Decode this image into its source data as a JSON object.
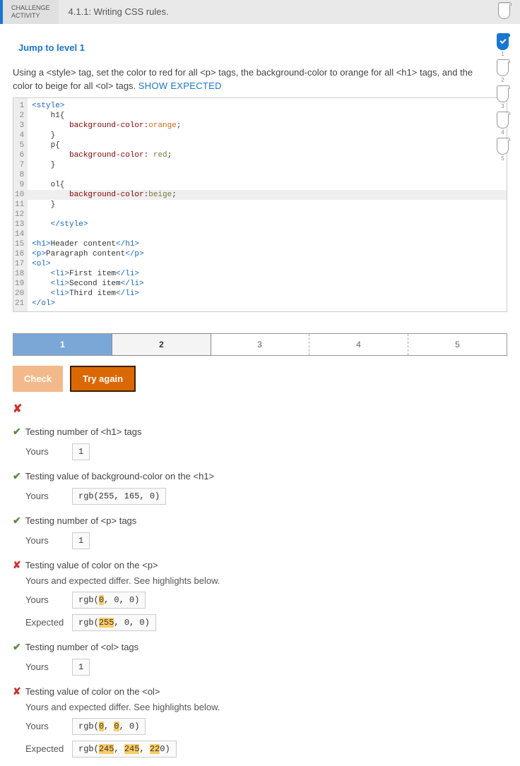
{
  "header": {
    "challenge_label_1": "CHALLENGE",
    "challenge_label_2": "ACTIVITY",
    "title": "4.1.1: Writing CSS rules."
  },
  "progress": [
    "1",
    "2",
    "3",
    "4",
    "5"
  ],
  "jump_link": "Jump to level 1",
  "instruction_pre": "Using a <style> tag, set the color to red for all <p> tags, the background-color to orange for all <h1> tags, and the color to beige for all <ol> tags.  ",
  "show_expected": "SHOW EXPECTED",
  "code_lines": {
    "l1": "<style>",
    "l2": "    h1{",
    "l3_prop": "        background-color:",
    "l3_val": "orange",
    "l3_end": ";",
    "l4": "    }",
    "l5": "    p{",
    "l6_prop": "        background-color: ",
    "l6_val": "red",
    "l6_end": ";",
    "l7": "    }",
    "l8": "",
    "l9": "    ol{",
    "l10_prop": "        background-color:",
    "l10_val": "beige",
    "l10_end": ";",
    "l11": "    }",
    "l12": "",
    "l13": "    </style>",
    "l14": "",
    "l15a": "<h1>",
    "l15b": "Header content",
    "l15c": "</h1>",
    "l16a": "<p>",
    "l16b": "Paragraph content",
    "l16c": "</p>",
    "l17": "<ol>",
    "l18a": "    <li>",
    "l18b": "First item",
    "l18c": "</li>",
    "l19a": "    <li>",
    "l19b": "Second item",
    "l19c": "</li>",
    "l20a": "    <li>",
    "l20b": "Third item",
    "l20c": "</li>",
    "l21": "</ol>"
  },
  "gutter": [
    "1",
    "2",
    "3",
    "4",
    "5",
    "6",
    "7",
    "8",
    "9",
    "10",
    "11",
    "12",
    "13",
    "14",
    "15",
    "16",
    "17",
    "18",
    "19",
    "20",
    "21"
  ],
  "levels": [
    "1",
    "2",
    "3",
    "4",
    "5"
  ],
  "buttons": {
    "check": "Check",
    "try_again": "Try again"
  },
  "tests": {
    "t1": {
      "label": "Testing number of <h1> tags",
      "yours_lbl": "Yours",
      "yours": "1"
    },
    "t2": {
      "label": "Testing value of background-color on the <h1>",
      "yours_lbl": "Yours",
      "yours": "rgb(255, 165, 0)"
    },
    "t3": {
      "label": "Testing number of <p> tags",
      "yours_lbl": "Yours",
      "yours": "1"
    },
    "t4": {
      "label": "Testing value of color on the <p>",
      "msg": "Yours and expected differ. See highlights below.",
      "yours_lbl": "Yours",
      "yours_a": "rgb(",
      "yours_h1": "0",
      "yours_b": ", 0, 0)",
      "exp_lbl": "Expected",
      "exp_a": "rgb(",
      "exp_h1": "255",
      "exp_b": ", 0, 0)"
    },
    "t5": {
      "label": "Testing number of <ol> tags",
      "yours_lbl": "Yours",
      "yours": "1"
    },
    "t6": {
      "label": "Testing value of color on the <ol>",
      "msg": "Yours and expected differ. See highlights below.",
      "yours_lbl": "Yours",
      "y_a": "rgb(",
      "y_h1": "0",
      "y_b": ", ",
      "y_h2": "0",
      "y_c": ", 0)",
      "exp_lbl": "Expected",
      "e_a": "rgb(",
      "e_h1": "245",
      "e_b": ", ",
      "e_h2": "245",
      "e_c": ", ",
      "e_h3": "22",
      "e_d": "0)"
    }
  }
}
